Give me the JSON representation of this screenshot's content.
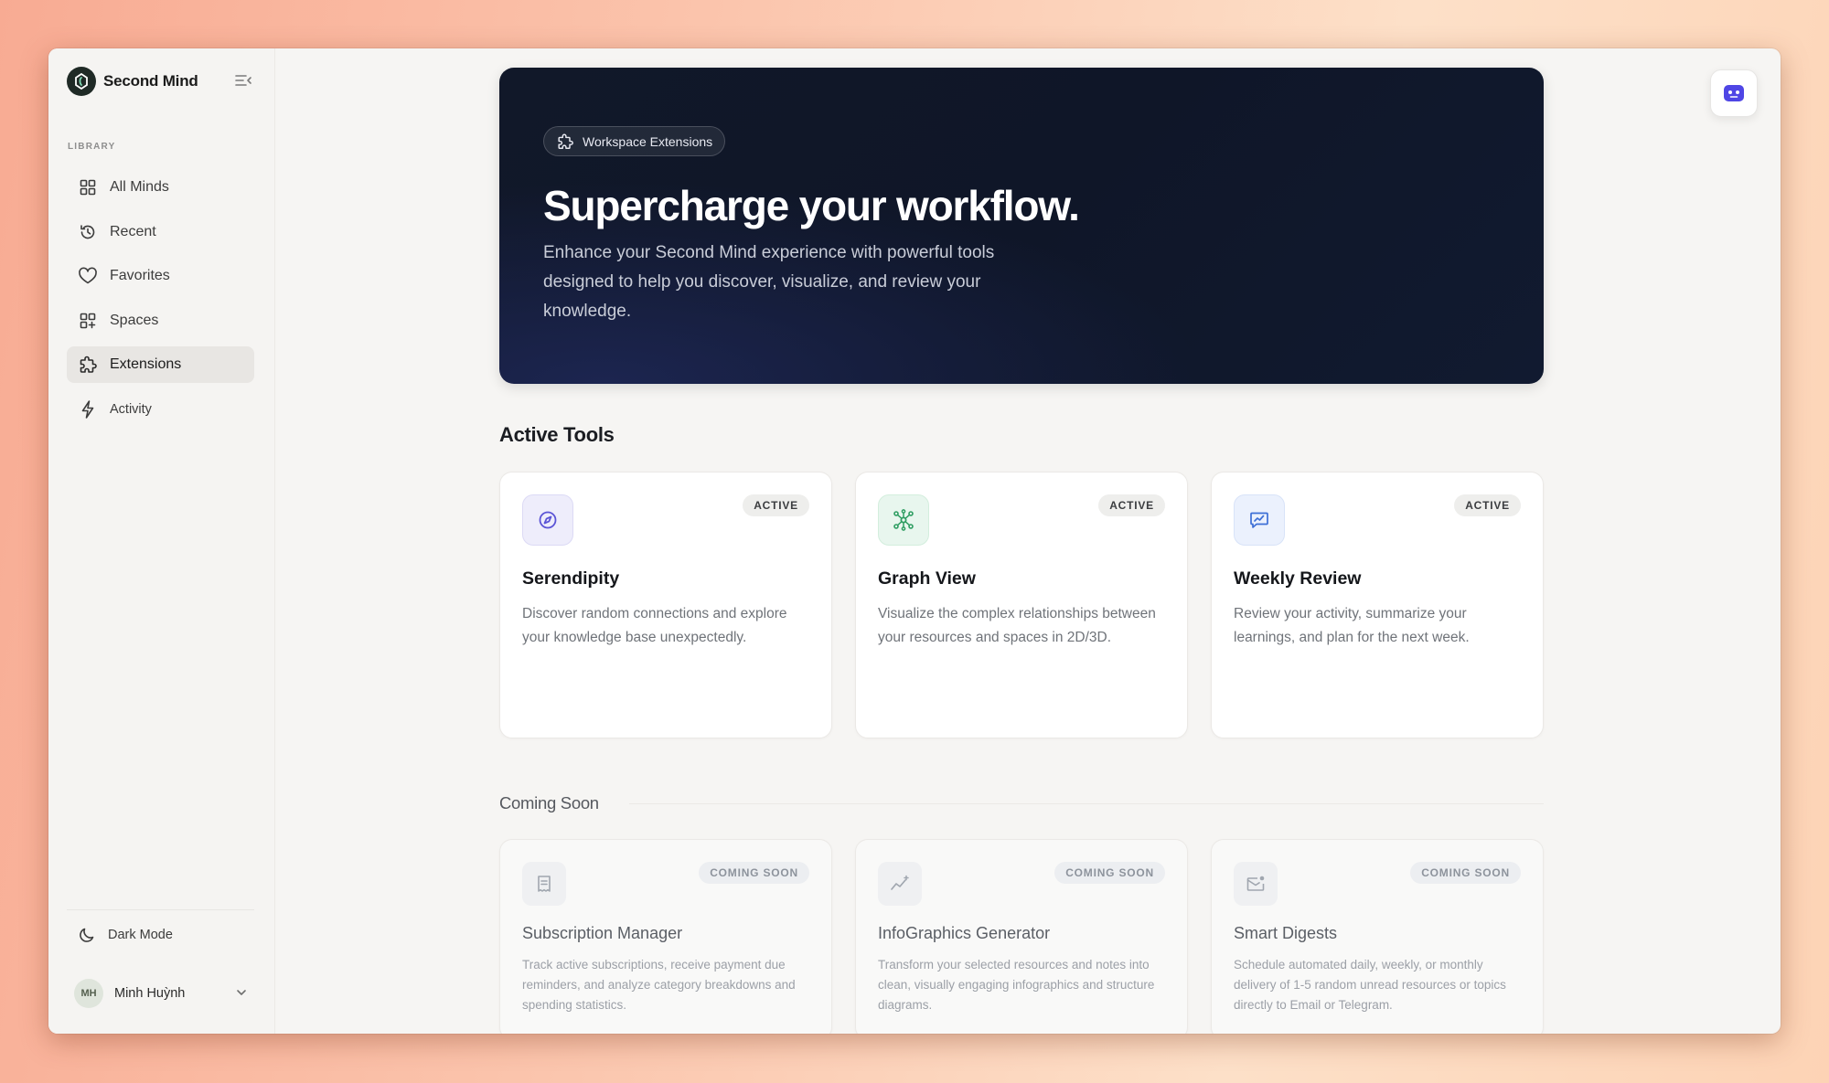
{
  "brand": {
    "name": "Second Mind",
    "logo_icon": "brain-logo-icon"
  },
  "sidebar": {
    "section_label": "LIBRARY",
    "items": [
      {
        "label": "All Minds",
        "icon": "grid-icon",
        "active": false
      },
      {
        "label": "Recent",
        "icon": "history-icon",
        "active": false
      },
      {
        "label": "Favorites",
        "icon": "heart-icon",
        "active": false
      },
      {
        "label": "Spaces",
        "icon": "grid-plus-icon",
        "active": false
      },
      {
        "label": "Extensions",
        "icon": "puzzle-icon",
        "active": true
      },
      {
        "label": "Activity",
        "icon": "bolt-icon",
        "active": false
      }
    ],
    "dark_mode_label": "Dark Mode",
    "user": {
      "initials": "MH",
      "name": "Minh Huỳnh"
    }
  },
  "hero": {
    "badge": "Workspace Extensions",
    "title": "Supercharge your workflow.",
    "description": "Enhance your Second Mind experience with powerful tools designed to help you discover, visualize, and review your knowledge."
  },
  "active_tools": {
    "title": "Active Tools",
    "cards": [
      {
        "title": "Serendipity",
        "badge": "ACTIVE",
        "description": "Discover random connections and explore your knowledge base unexpectedly.",
        "icon": "compass-icon",
        "icon_bg": "#eeedfb",
        "icon_color": "#5b54d6"
      },
      {
        "title": "Graph View",
        "badge": "ACTIVE",
        "description": "Visualize the complex relationships between your resources and spaces in 2D/3D.",
        "icon": "network-icon",
        "icon_bg": "#e8f6ee",
        "icon_color": "#2f9e62"
      },
      {
        "title": "Weekly Review",
        "badge": "ACTIVE",
        "description": "Review your activity, summarize your learnings, and plan for the next week.",
        "icon": "chart-message-icon",
        "icon_bg": "#ebf1fd",
        "icon_color": "#3d6fd6"
      }
    ]
  },
  "coming_soon": {
    "title": "Coming Soon",
    "cards": [
      {
        "title": "Subscription Manager",
        "badge": "COMING SOON",
        "description": "Track active subscriptions, receive payment due reminders, and analyze category breakdowns and spending statistics.",
        "icon": "receipt-icon"
      },
      {
        "title": "InfoGraphics Generator",
        "badge": "COMING SOON",
        "description": "Transform your selected resources and notes into clean, visually engaging infographics and structure diagrams.",
        "icon": "sparkle-chart-icon"
      },
      {
        "title": "Smart Digests",
        "badge": "COMING SOON",
        "description": "Schedule automated daily, weekly, or monthly delivery of 1-5 random unread resources or topics directly to Email or Telegram.",
        "icon": "mail-icon"
      }
    ]
  },
  "assistant_button": {
    "icon": "bot-icon",
    "color": "#4f46e5"
  }
}
